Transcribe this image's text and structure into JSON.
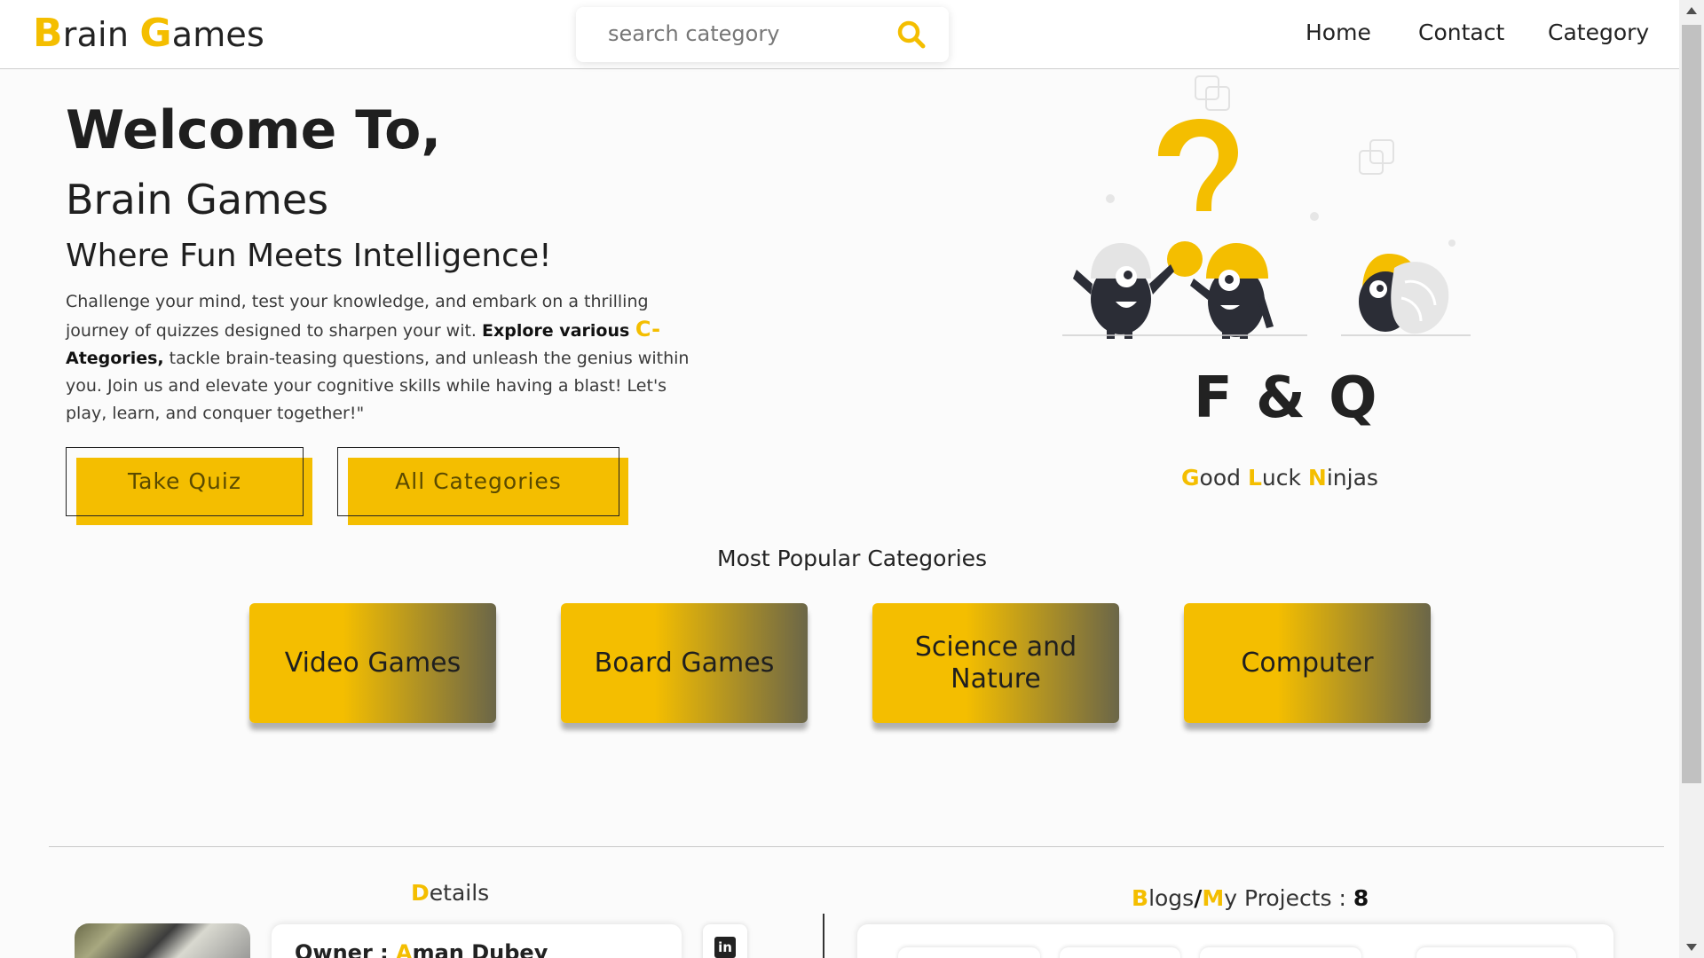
{
  "header": {
    "logo": {
      "b": "B",
      "rain": "rain ",
      "g": "G",
      "ames": "ames"
    },
    "search": {
      "placeholder": "search category",
      "icon": "search-icon"
    },
    "nav": [
      "Home",
      "Contact",
      "Category"
    ]
  },
  "hero": {
    "welcome": "Welcome To,",
    "brand": "Brain Games",
    "tagline": "Where Fun Meets Intelligence!",
    "desc_part1": "Challenge your mind, test your knowledge, and embark on a thrilling journey of quizzes designed to sharpen your wit. ",
    "desc_bold1": "Explore various ",
    "desc_c": "C-",
    "desc_bold2": "Ategories,",
    "desc_part2": " tackle brain-teasing questions, and unleash the genius within you. Join us and elevate your cognitive skills while having a blast! Let's play, learn, and conquer together!\"",
    "buttons": {
      "take_quiz": "Take Quiz",
      "all_categories": "All Categories"
    }
  },
  "side": {
    "fq": "F & Q",
    "good_luck": {
      "g": "G",
      "ood": "ood ",
      "l": "L",
      "uck": "uck ",
      "n": "N",
      "injas": "injas"
    }
  },
  "popular": {
    "title": "Most Popular Categories",
    "categories": [
      "Video Games",
      "Board Games",
      "Science and Nature",
      "Computer"
    ]
  },
  "footer": {
    "details": {
      "d": "D",
      "rest": "etails"
    },
    "owner_label": "Owner :",
    "owner_name": {
      "a": "A",
      "rest": "man Dubey"
    },
    "linkedin_icon": "linkedin-icon",
    "blogs": {
      "b": "B",
      "logs": "logs",
      "slash": "/",
      "m": "M",
      "y_projects": "y Projects : ",
      "count": "8"
    }
  },
  "colors": {
    "accent": "#f4be00",
    "dark": "#222222",
    "gradient_end": "#6b6648"
  }
}
